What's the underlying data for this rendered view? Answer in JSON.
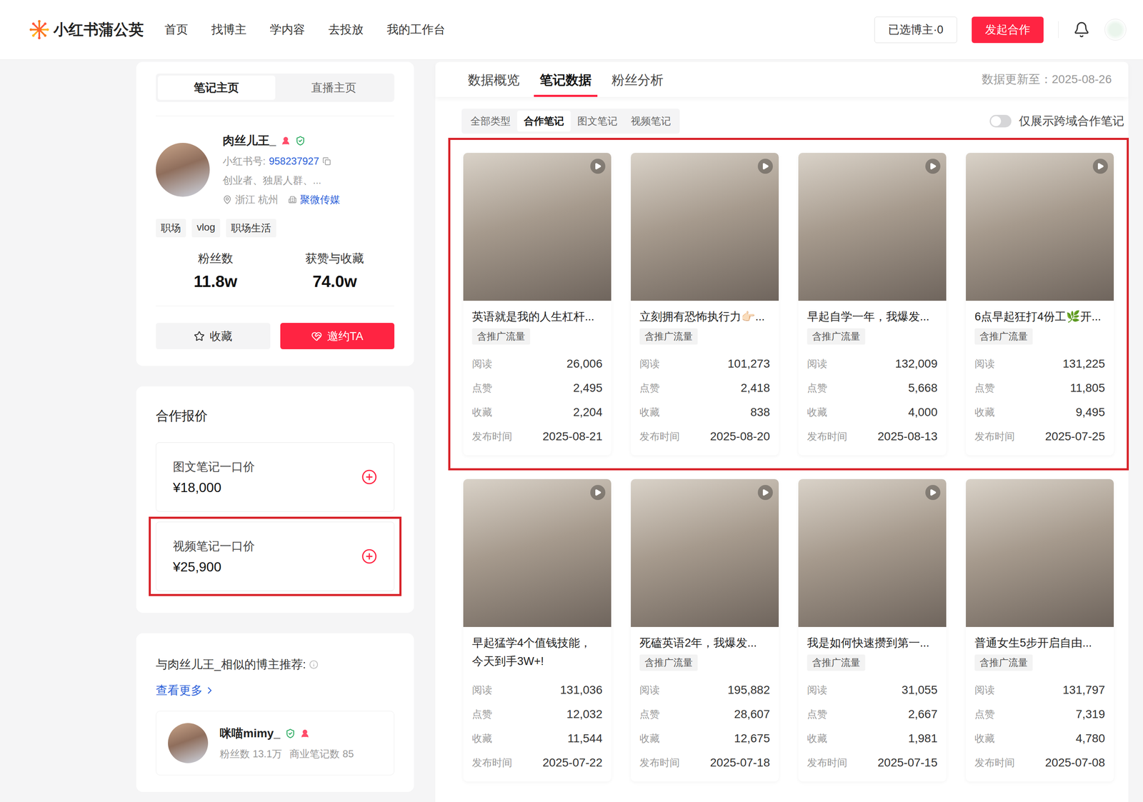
{
  "header": {
    "logo": "小红书蒲公英",
    "nav": [
      "首页",
      "找博主",
      "学内容",
      "去投放",
      "我的工作台"
    ],
    "selected_button": "已选博主·0",
    "cta": "发起合作"
  },
  "profile": {
    "tabs": [
      {
        "label": "笔记主页",
        "selected": true
      },
      {
        "label": "直播主页",
        "selected": false
      }
    ],
    "name": "肉丝儿王_",
    "id_label": "小红书号:",
    "id": "958237927",
    "bio": "创业者、独居人群、...",
    "location": "浙江 杭州",
    "agency": "聚微传媒",
    "tags": [
      "职场",
      "vlog",
      "职场生活"
    ],
    "stats": [
      {
        "label": "粉丝数",
        "value": "11.8w"
      },
      {
        "label": "获赞与收藏",
        "value": "74.0w"
      }
    ],
    "buttons": {
      "favorite": "收藏",
      "invite": "邀约TA"
    }
  },
  "pricing": {
    "title": "合作报价",
    "items": [
      {
        "label": "图文笔记一口价",
        "price": "¥18,000",
        "highlighted": false
      },
      {
        "label": "视频笔记一口价",
        "price": "¥25,900",
        "highlighted": true
      }
    ]
  },
  "similar": {
    "title": "与肉丝儿王_相似的博主推荐:",
    "more": "查看更多",
    "bloggers": [
      {
        "name": "咪喵mimy_",
        "fans": "粉丝数 13.1万",
        "notes": "商业笔记数 85"
      }
    ]
  },
  "data_panel": {
    "tabs": [
      {
        "label": "数据概览",
        "selected": false
      },
      {
        "label": "笔记数据",
        "selected": true
      },
      {
        "label": "粉丝分析",
        "selected": false
      }
    ],
    "updated": "数据更新至：2025-08-26",
    "filters": [
      {
        "label": "全部类型",
        "selected": false
      },
      {
        "label": "合作笔记",
        "selected": true
      },
      {
        "label": "图文笔记",
        "selected": false
      },
      {
        "label": "视频笔记",
        "selected": false
      }
    ],
    "toggle": {
      "label": "仅展示跨域合作笔记",
      "on": false
    },
    "stat_labels": [
      "阅读",
      "点赞",
      "收藏",
      "发布时间"
    ],
    "rows": [
      {
        "highlighted": true,
        "notes": [
          {
            "title": "英语就是我的人生杠杆...",
            "tag": "含推广流量",
            "video": true,
            "values": [
              "26,006",
              "2,495",
              "2,204",
              "2025-08-21"
            ]
          },
          {
            "title": "立刻拥有恐怖执行力👉🏻...",
            "tag": "含推广流量",
            "video": true,
            "values": [
              "101,273",
              "2,418",
              "838",
              "2025-08-20"
            ]
          },
          {
            "title": "早起自学一年，我爆发...",
            "tag": "含推广流量",
            "video": true,
            "values": [
              "132,009",
              "5,668",
              "4,000",
              "2025-08-13"
            ]
          },
          {
            "title": "6点早起狂打4份工🌿开...",
            "tag": "含推广流量",
            "video": true,
            "values": [
              "131,225",
              "11,805",
              "9,495",
              "2025-07-25"
            ]
          }
        ]
      },
      {
        "highlighted": false,
        "notes": [
          {
            "title": "早起猛学4个值钱技能，今天到手3W+!",
            "tag": null,
            "video": true,
            "values": [
              "131,036",
              "12,032",
              "11,544",
              "2025-07-22"
            ]
          },
          {
            "title": "死磕英语2年，我爆发...",
            "tag": "含推广流量",
            "video": true,
            "values": [
              "195,882",
              "28,607",
              "12,675",
              "2025-07-18"
            ]
          },
          {
            "title": "我是如何快速攒到第一...",
            "tag": "含推广流量",
            "video": true,
            "values": [
              "31,055",
              "2,667",
              "1,981",
              "2025-07-15"
            ]
          },
          {
            "title": "普通女生5步开启自由...",
            "tag": "含推广流量",
            "video": false,
            "values": [
              "131,797",
              "7,319",
              "4,780",
              "2025-07-08"
            ]
          }
        ]
      }
    ]
  }
}
